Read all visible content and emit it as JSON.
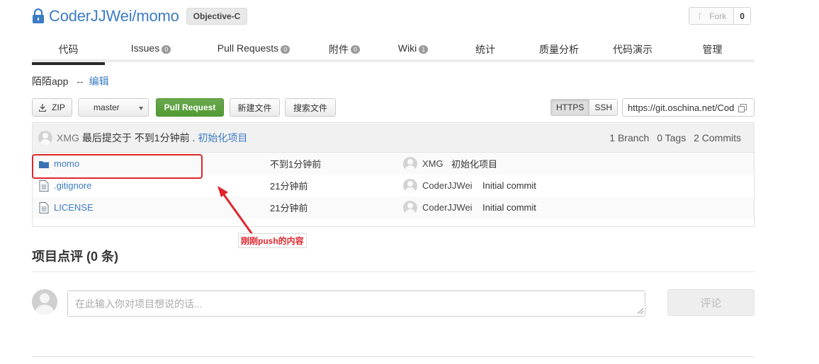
{
  "repo": {
    "title": "CoderJJWei/momo",
    "language": "Objective-C",
    "fork_label": "Fork",
    "fork_count": "0"
  },
  "tabs": [
    {
      "label": "代码",
      "count": null,
      "active": true
    },
    {
      "label": "Issues",
      "count": "0"
    },
    {
      "label": "Pull Requests",
      "count": "0"
    },
    {
      "label": "附件",
      "count": "0"
    },
    {
      "label": "Wiki",
      "count": "1"
    },
    {
      "label": "统计",
      "count": null
    },
    {
      "label": "质量分析",
      "count": null
    },
    {
      "label": "代码演示",
      "count": null
    },
    {
      "label": "管理",
      "count": null
    }
  ],
  "description": {
    "text": "陌陌app",
    "separator": "--",
    "edit_label": "编辑"
  },
  "toolbar": {
    "zip_label": "ZIP",
    "branch": "master",
    "pull_request_label": "Pull Request",
    "new_file_label": "新建文件",
    "search_file_label": "搜索文件",
    "https_label": "HTTPS",
    "ssh_label": "SSH",
    "clone_url": "https://git.oschina.net/CoderJJWei/momo.git"
  },
  "latest_commit": {
    "author": "XMG",
    "text": "最后提交于 不到1分钟前 .",
    "message": "初始化项目",
    "branches": "1 Branch",
    "tags": "0 Tags",
    "commits": "2 Commits"
  },
  "files": [
    {
      "type": "folder",
      "name": "momo",
      "time": "不到1分钟前",
      "author": "XMG",
      "message": "初始化项目"
    },
    {
      "type": "file",
      "name": ".gitignore",
      "time": "21分钟前",
      "author": "CoderJJWei",
      "message": "Initial commit"
    },
    {
      "type": "file",
      "name": "LICENSE",
      "time": "21分钟前",
      "author": "CoderJJWei",
      "message": "Initial commit"
    }
  ],
  "annotation": {
    "callout": "刚刚push的内容",
    "color": "#e0252c"
  },
  "review": {
    "title": "项目点评 (0 条)",
    "placeholder": "在此输入你对项目想说的话...",
    "submit_label": "评论"
  },
  "colors": {
    "link": "#3b7cc6",
    "primary_button": "#5aa13d"
  }
}
